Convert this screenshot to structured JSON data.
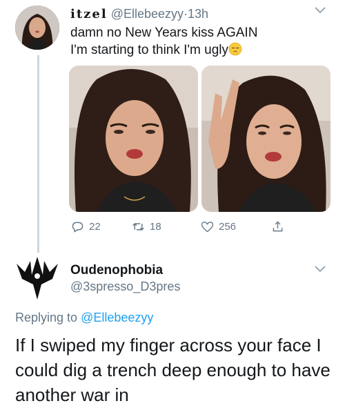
{
  "tweet": {
    "display_name": "itzel",
    "handle": "@Ellebeezyy",
    "separator": "·",
    "time": "13h",
    "text_line1": "damn no New Years kiss AGAIN",
    "text_line2": "I'm starting to think I'm ugly",
    "emoji": "pensive-face",
    "stats": {
      "replies": "22",
      "retweets": "18",
      "likes": "256"
    }
  },
  "reply": {
    "display_name": "Oudenophobia",
    "handle": "@3spresso_D3pres",
    "replying_prefix": "Replying to",
    "replying_to": "@Ellebeezyy",
    "text": "If I swiped my finger across your face I could dig a trench deep enough to have another war in"
  },
  "colors": {
    "text": "#14171a",
    "muted": "#657786",
    "link": "#1da1f2",
    "thread_line": "#ccd6dd"
  }
}
